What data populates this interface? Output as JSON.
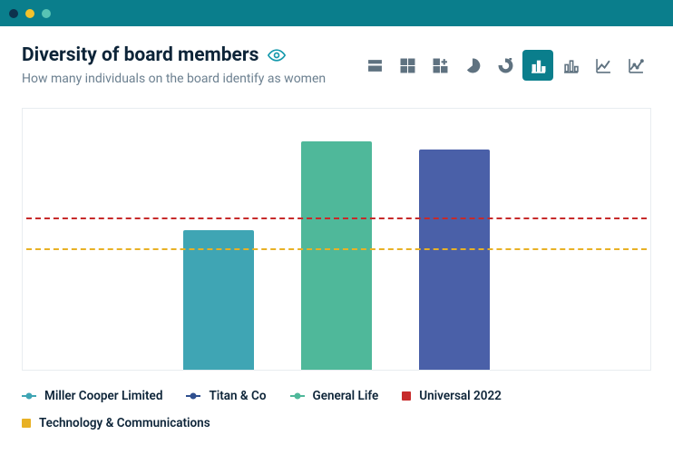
{
  "window": {
    "title": "Diversity of board members",
    "subtitle": "How many individuals on the board identify as women"
  },
  "toolbar": {
    "items": [
      {
        "name": "rows-icon",
        "selected": false
      },
      {
        "name": "grid-icon",
        "selected": false
      },
      {
        "name": "grid-add-icon",
        "selected": false
      },
      {
        "name": "pie-icon",
        "selected": false
      },
      {
        "name": "donut-split-icon",
        "selected": false
      },
      {
        "name": "bar-chart-icon",
        "selected": true
      },
      {
        "name": "bar-chart-alt-icon",
        "selected": false
      },
      {
        "name": "line-chart-icon",
        "selected": false
      },
      {
        "name": "line-chart-alt-icon",
        "selected": false
      }
    ]
  },
  "chart_data": {
    "type": "bar",
    "title": "Diversity of board members",
    "subtitle": "How many individuals on the board identify as women",
    "xlabel": "",
    "ylabel": "",
    "ylim": [
      0,
      100
    ],
    "categories": [
      "Miller Cooper Limited",
      "Titan & Co",
      "General Life"
    ],
    "series": [
      {
        "name": "Miller Cooper Limited",
        "color": "#3fa5b4",
        "value": 54
      },
      {
        "name": "Titan & Co",
        "color": "#4fb89a",
        "value": 88
      },
      {
        "name": "General Life",
        "color": "#4a60a8",
        "value": 85
      }
    ],
    "reference_lines": [
      {
        "name": "Universal 2022",
        "color": "#c72a2a",
        "value": 58
      },
      {
        "name": "Technology & Communications",
        "color": "#e8b125",
        "value": 46
      }
    ]
  },
  "legend": {
    "items": [
      {
        "label": "Miller Cooper Limited",
        "kind": "line",
        "color_class": "c-miller"
      },
      {
        "label": "Titan & Co",
        "kind": "line",
        "color_class": "c-titan"
      },
      {
        "label": "General Life",
        "kind": "line",
        "color_class": "c-general"
      },
      {
        "label": "Universal 2022",
        "kind": "square",
        "color_class": "c-universal"
      },
      {
        "label": "Technology & Communications",
        "kind": "square",
        "color_class": "c-techcomm"
      }
    ]
  }
}
